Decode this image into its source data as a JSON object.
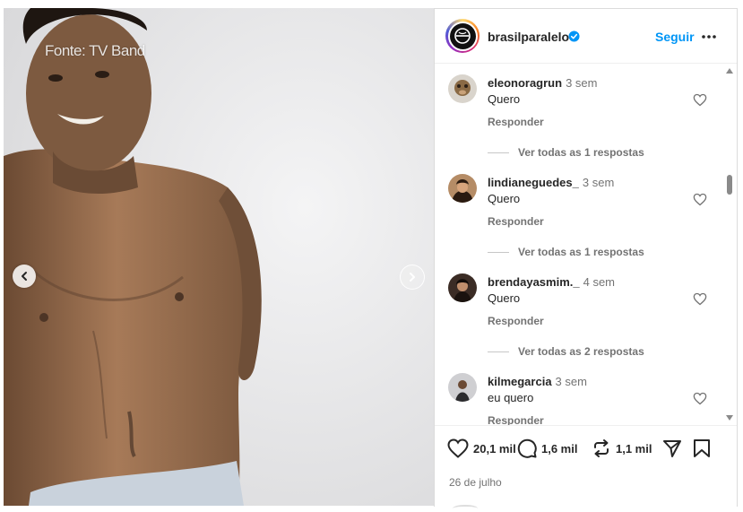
{
  "media": {
    "watermark": "Fonte: TV Band"
  },
  "post": {
    "username": "brasilparalelo",
    "follow_label": "Seguir",
    "likes": "20,1 mil",
    "comments_count": "1,6 mil",
    "reposts": "1,1 mil",
    "date": "26 de julho"
  },
  "comments": [
    {
      "user": "eleonoragrun",
      "time": "3 sem",
      "text": "Quero",
      "reply_label": "Responder",
      "view_replies": "Ver todas as 1 respostas"
    },
    {
      "user": "lindianeguedes_",
      "time": "3 sem",
      "text": "Quero",
      "reply_label": "Responder",
      "view_replies": "Ver todas as 1 respostas"
    },
    {
      "user": "brendayasmim._",
      "time": "4 sem",
      "text": "Quero",
      "reply_label": "Responder",
      "view_replies": "Ver todas as 2 respostas"
    },
    {
      "user": "kilmegarcia",
      "time": "3 sem",
      "text": "eu quero",
      "reply_label": "Responder"
    }
  ],
  "colors": {
    "accent": "#0095f6",
    "text": "#262626",
    "muted": "#737373"
  },
  "icons": [
    "chevron-left-icon",
    "chevron-right-icon",
    "verified-badge-icon",
    "more-icon",
    "heart-icon",
    "comment-icon",
    "repost-icon",
    "share-icon",
    "bookmark-icon"
  ]
}
